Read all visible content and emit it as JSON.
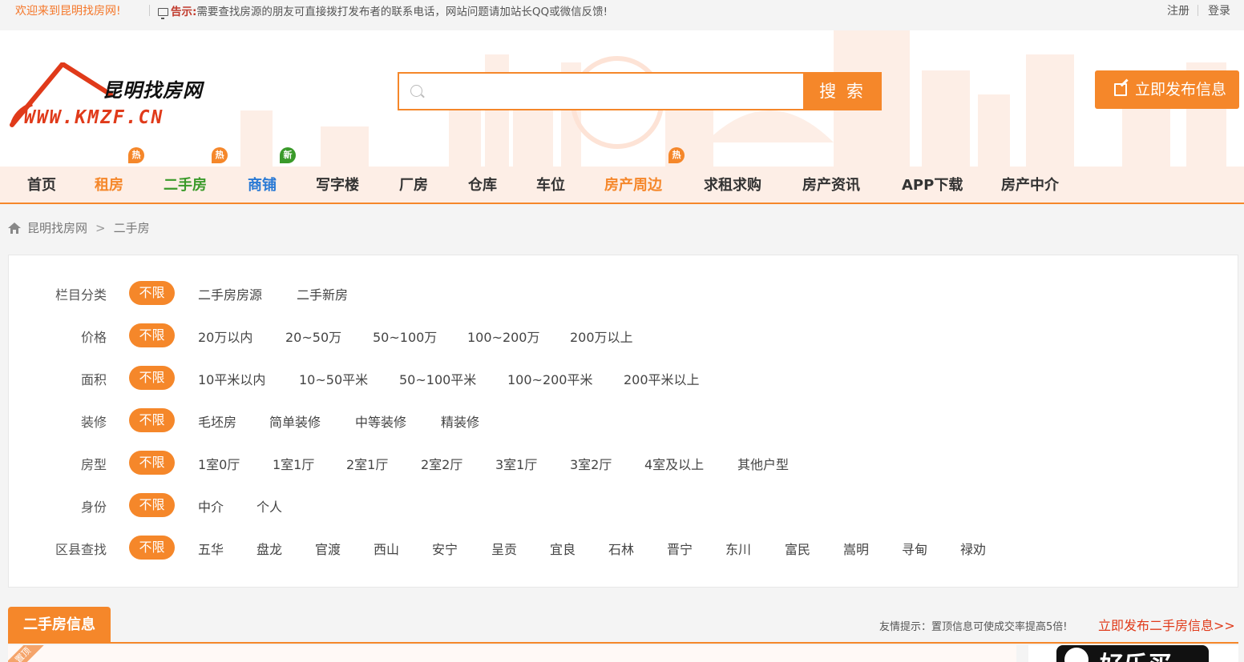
{
  "topbar": {
    "welcome": "欢迎来到昆明找房网!",
    "notice_label": "告示:",
    "notice_text": "需要查找房源的朋友可直接拨打发布者的联系电话，网站问题请加站长QQ或微信反馈!",
    "register": "注册",
    "login": "登录"
  },
  "header": {
    "logo_cn": "昆明找房网",
    "logo_url": "WWW.KMZF.CN",
    "search_placeholder": "",
    "search_button": "搜 索",
    "publish_button": "立即发布信息"
  },
  "nav": [
    {
      "label": "首页",
      "badge": ""
    },
    {
      "label": "租房",
      "badge": "热"
    },
    {
      "label": "二手房",
      "badge": "热"
    },
    {
      "label": "商铺",
      "badge": "新"
    },
    {
      "label": "写字楼",
      "badge": ""
    },
    {
      "label": "厂房",
      "badge": ""
    },
    {
      "label": "仓库",
      "badge": ""
    },
    {
      "label": "车位",
      "badge": ""
    },
    {
      "label": "房产周边",
      "badge": "热"
    },
    {
      "label": "求租求购",
      "badge": ""
    },
    {
      "label": "房产资讯",
      "badge": ""
    },
    {
      "label": "APP下载",
      "badge": ""
    },
    {
      "label": "房产中介",
      "badge": ""
    }
  ],
  "breadcrumb": {
    "home": "昆明找房网",
    "sep": ">",
    "current": "二手房"
  },
  "filters": {
    "category": {
      "label": "栏目分类",
      "options": [
        "不限",
        "二手房房源",
        "二手新房"
      ]
    },
    "price": {
      "label": "价格",
      "options": [
        "不限",
        "20万以内",
        "20~50万",
        "50~100万",
        "100~200万",
        "200万以上"
      ]
    },
    "area": {
      "label": "面积",
      "options": [
        "不限",
        "10平米以内",
        "10~50平米",
        "50~100平米",
        "100~200平米",
        "200平米以上"
      ]
    },
    "decoration": {
      "label": "装修",
      "options": [
        "不限",
        "毛坯房",
        "简单装修",
        "中等装修",
        "精装修"
      ]
    },
    "layout": {
      "label": "房型",
      "options": [
        "不限",
        "1室0厅",
        "1室1厅",
        "2室1厅",
        "2室2厅",
        "3室1厅",
        "3室2厅",
        "4室及以上",
        "其他户型"
      ]
    },
    "identity": {
      "label": "身份",
      "options": [
        "不限",
        "中介",
        "个人"
      ]
    },
    "district": {
      "label": "区县查找",
      "options": [
        "不限",
        "五华",
        "盘龙",
        "官渡",
        "西山",
        "安宁",
        "呈贡",
        "宜良",
        "石林",
        "晋宁",
        "东川",
        "富民",
        "嵩明",
        "寻甸",
        "禄劝"
      ]
    }
  },
  "section": {
    "title": "二手房信息",
    "tip": "友情提示：置顶信息可使成交率提高5倍!",
    "publish_link": "立即发布二手房信息>>",
    "ribbon": "置顶",
    "ad_text": "好乐买"
  },
  "colors": {
    "accent": "#f5872a",
    "hot_red": "#e03a1a",
    "green": "#3a9a2a",
    "blue": "#2a7ad5"
  }
}
